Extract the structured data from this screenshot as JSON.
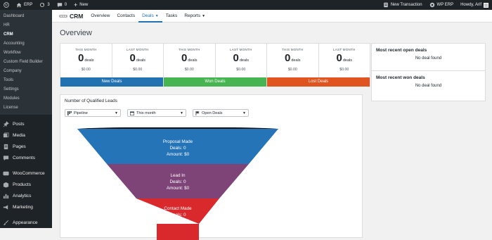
{
  "adminbar": {
    "site": "ERP",
    "updates": "3",
    "comments": "0",
    "new": "New",
    "new_transaction": "New Transaction",
    "wp_erp": "WP ERP",
    "howdy": "Howdy, Arif"
  },
  "sidebar": {
    "submenu": [
      "Dashboard",
      "HR",
      "CRM",
      "Accounting",
      "Workflow",
      "Custom Field Builder",
      "Company",
      "Tools",
      "Settings",
      "Modules",
      "License"
    ],
    "active_index": 2,
    "menu": [
      {
        "label": "Posts",
        "icon": "pin-icon"
      },
      {
        "label": "Media",
        "icon": "media-icon"
      },
      {
        "label": "Pages",
        "icon": "page-icon"
      },
      {
        "label": "Comments",
        "icon": "comment-icon"
      },
      {
        "label": "WooCommerce",
        "icon": "woo-icon"
      },
      {
        "label": "Products",
        "icon": "box-icon"
      },
      {
        "label": "Analytics",
        "icon": "bar-chart-icon"
      },
      {
        "label": "Marketing",
        "icon": "megaphone-icon"
      },
      {
        "label": "Appearance",
        "icon": "brush-icon"
      }
    ]
  },
  "topnav": {
    "brand": "CRM",
    "tabs": [
      "Overview",
      "Contacts",
      "Deals",
      "Tasks",
      "Reports"
    ],
    "active_tab": "Deals"
  },
  "page_title": "Overview",
  "stats": [
    {
      "left_label": "THIS MONTH",
      "left_value": "0",
      "left_unit": "deals",
      "left_amount": "$0.00",
      "right_label": "LAST MONTH",
      "right_value": "0",
      "right_unit": "deals",
      "right_amount": "$0.00",
      "footer": "New Deals",
      "color": "#2271b1"
    },
    {
      "left_label": "THIS MONTH",
      "left_value": "0",
      "left_unit": "deals",
      "left_amount": "$0.00",
      "right_label": "LAST MONTH",
      "right_value": "0",
      "right_unit": "deals",
      "right_amount": "$0.00",
      "footer": "Won Deals",
      "color": "#46b450"
    },
    {
      "left_label": "THIS MONTH",
      "left_value": "0",
      "left_unit": "deals",
      "left_amount": "$0.00",
      "right_label": "LAST MONTH",
      "right_value": "0",
      "right_unit": "deals",
      "right_amount": "$0.00",
      "footer": "Lost Deals",
      "color": "#e0541f"
    }
  ],
  "open_deals": {
    "title": "Most recent open deals",
    "empty": "No deal found"
  },
  "won_deals": {
    "title": "Most recent won deals",
    "empty": "No deal found"
  },
  "leads": {
    "title": "Number of Qualified Leads",
    "filters": [
      {
        "value": "Pipeline",
        "icon": "pipeline-icon"
      },
      {
        "value": "This month",
        "icon": "calendar-icon"
      },
      {
        "value": "Open Deals",
        "icon": "flag-icon"
      }
    ],
    "stages": [
      {
        "name": "Proposal Made",
        "deals": "Deals: 0",
        "amount": "Amount: $0",
        "color": "#2574b8"
      },
      {
        "name": "Lead In",
        "deals": "Deals: 0",
        "amount": "Amount: $0",
        "color": "#7e4478"
      },
      {
        "name": "Contact Made",
        "deals": "Deals: 0",
        "amount": "Amount: $0",
        "color": "#d9292d"
      }
    ]
  }
}
